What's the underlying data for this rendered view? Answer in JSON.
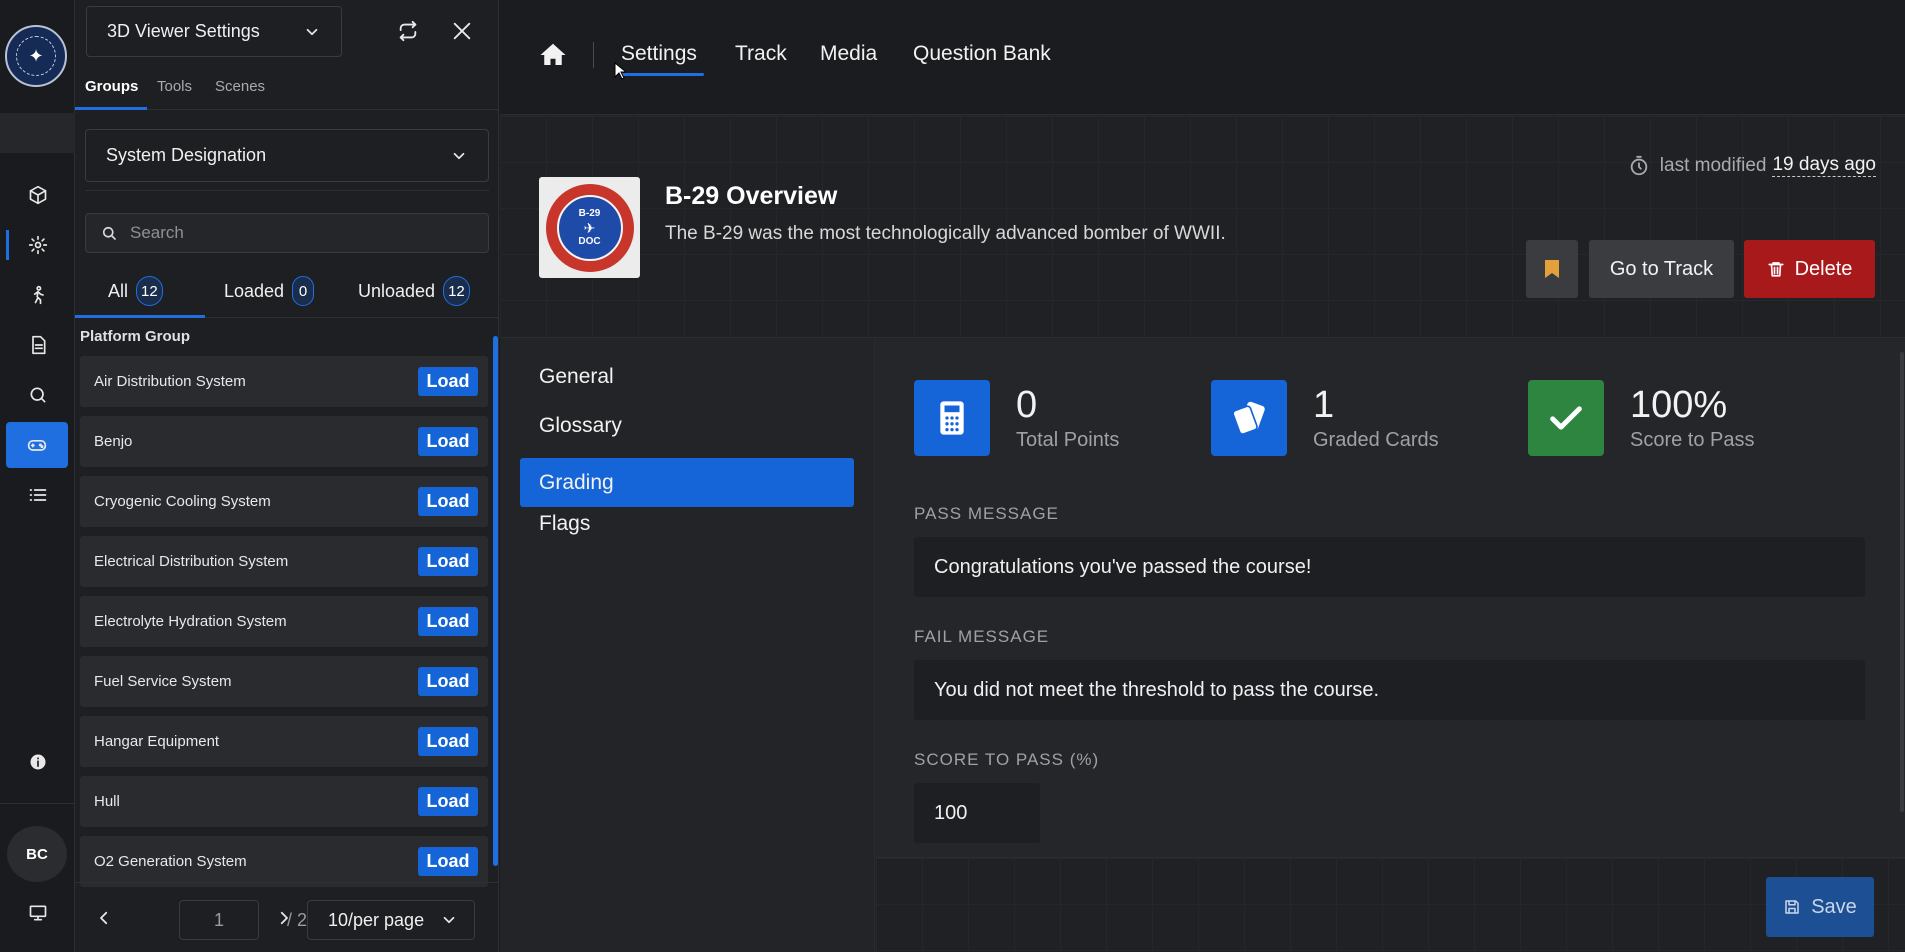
{
  "panel": {
    "viewer_select": "3D Viewer Settings",
    "tabs": [
      "Groups",
      "Tools",
      "Scenes"
    ],
    "group_select": "System Designation",
    "search_placeholder": "Search",
    "filters": [
      {
        "label": "All",
        "count": "12"
      },
      {
        "label": "Loaded",
        "count": "0"
      },
      {
        "label": "Unloaded",
        "count": "12"
      }
    ],
    "group_heading": "Platform Group",
    "load_label": "Load",
    "items": [
      "Air Distribution System",
      "Benjo",
      "Cryogenic Cooling System",
      "Electrical Distribution System",
      "Electrolyte Hydration System",
      "Fuel Service System",
      "Hangar Equipment",
      "Hull",
      "O2 Generation System"
    ],
    "pager": {
      "page": "1",
      "total": "/ 2",
      "per_page": "10/per page"
    }
  },
  "rail": {
    "avatar_initials": "BC"
  },
  "nav": {
    "links": [
      "Settings",
      "Track",
      "Media",
      "Question Bank"
    ]
  },
  "course": {
    "title": "B-29 Overview",
    "description": "The B-29 was the most technologically advanced bomber of WWII.",
    "last_modified_label": "last modified",
    "last_modified_value": "19 days ago",
    "go_to_track": "Go to Track",
    "delete": "Delete",
    "logo_text": [
      "B-29",
      "DOC"
    ]
  },
  "sidenav": {
    "items": [
      "General",
      "Glossary",
      "Grading",
      "Flags"
    ],
    "active": "Grading"
  },
  "grading": {
    "stats": [
      {
        "value": "0",
        "label": "Total Points",
        "color": "#1565d8",
        "icon": "calculator-icon"
      },
      {
        "value": "1",
        "label": "Graded Cards",
        "color": "#1565d8",
        "icon": "cards-icon"
      },
      {
        "value": "100%",
        "label": "Score to Pass",
        "color": "#2e8540",
        "icon": "check-icon"
      }
    ],
    "pass_label": "PASS MESSAGE",
    "pass_value": "Congratulations you've passed the course!",
    "fail_label": "FAIL MESSAGE",
    "fail_value": "You did not meet the threshold to pass the course.",
    "score_label": "SCORE TO PASS (%)",
    "score_value": "100",
    "save": "Save"
  }
}
